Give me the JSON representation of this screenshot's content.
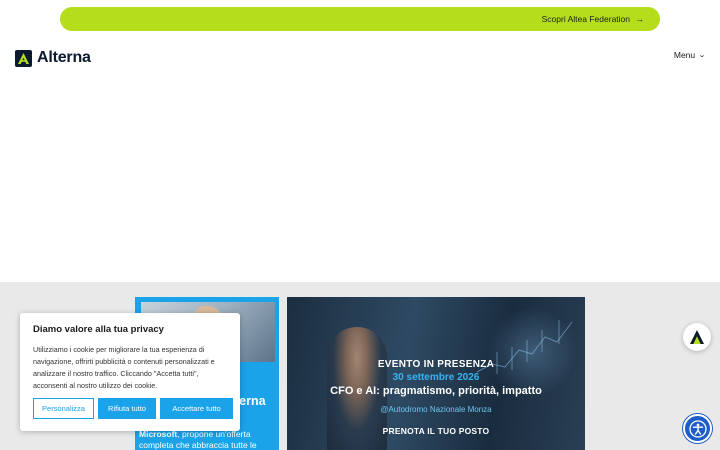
{
  "banner": {
    "text": "Scopri Altea Federation",
    "arrow": "→"
  },
  "header": {
    "logo_text": "Alterna",
    "menu_label": "Menu",
    "menu_icon": "chevron-down-icon"
  },
  "card_left": {
    "heading": "terna",
    "text_bold": "Microsoft",
    "text_rest": ", propone un'offerta completa che abbraccia tutte le"
  },
  "event": {
    "line1": "EVENTO IN PRESENZA",
    "line2": "30 settembre 2026",
    "line3": "CFO e AI: pragmatismo, priorità, impatto",
    "line4": "@Autodromo Nazionale Monza",
    "cta": "PRENOTA IL TUO POSTO"
  },
  "cookie": {
    "title": "Diamo valore alla tua privacy",
    "body": "Utilizziamo i cookie per migliorare la tua esperienza di navigazione, offrirti pubblicità o contenuti personalizzati e analizzare il nostro traffico. Cliccando \"Accetta tutti\", acconsenti al nostro utilizzo dei cookie.",
    "btn_customize": "Personalizza",
    "btn_reject": "Rifiuta tutto",
    "btn_accept": "Accettare tutto"
  },
  "colors": {
    "banner": "#b5dd1c",
    "accent": "#1aa3e8",
    "navy": "#0b1a2e",
    "access": "#1e5cc8"
  }
}
